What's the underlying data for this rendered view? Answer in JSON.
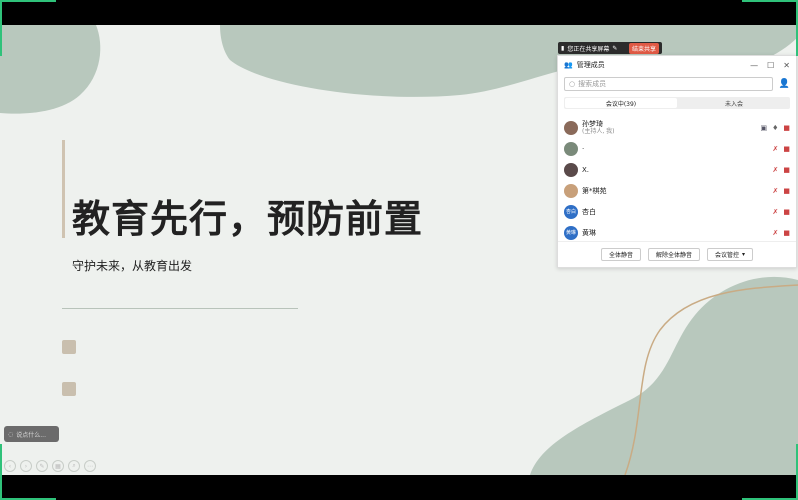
{
  "slide": {
    "title": "教育先行，预防前置",
    "subtitle": "守护未来，从教育出发"
  },
  "share_bar": {
    "status": "您正在共享屏幕",
    "end_label": "结束共享"
  },
  "panel": {
    "title": "管理成员",
    "search_placeholder": "搜索成员",
    "tabs": [
      {
        "label": "会议中(39)",
        "active": true
      },
      {
        "label": "未入会",
        "active": false
      }
    ],
    "members": [
      {
        "name": "孙梦琦",
        "role": "(主持人, 我)",
        "avatar_text": "",
        "avatar_color": "#8a6a5a"
      },
      {
        "name": "·",
        "role": "",
        "avatar_text": "",
        "avatar_color": "#7a8a7a"
      },
      {
        "name": "X.",
        "role": "",
        "avatar_text": "",
        "avatar_color": "#5a4a4a"
      },
      {
        "name": "第*棋苑",
        "role": "",
        "avatar_text": "",
        "avatar_color": "#c8a07a"
      },
      {
        "name": "杏白",
        "role": "",
        "avatar_text": "杏白",
        "avatar_color": "#2f6fc6"
      },
      {
        "name": "黄琳",
        "role": "",
        "avatar_text": "黄琳",
        "avatar_color": "#2f6fc6"
      }
    ],
    "footer": {
      "mute_all": "全体静音",
      "unmute_all": "解除全体静音",
      "meeting_control": "会议管控"
    }
  },
  "comment_box": {
    "placeholder": "说点什么..."
  },
  "colors": {
    "slide_bg": "#eef1ee",
    "blob": "#b8c8bd",
    "accent": "#cfc3b1",
    "end_share": "#e05a45",
    "avatar_blue": "#2f6fc6"
  }
}
